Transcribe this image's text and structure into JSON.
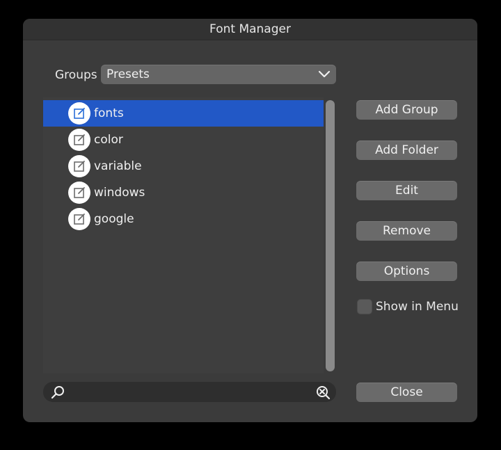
{
  "window": {
    "title": "Font Manager"
  },
  "groups": {
    "label": "Groups",
    "selected": "Presets",
    "icon": "chevron-down-icon"
  },
  "list": {
    "items": [
      {
        "label": "fonts",
        "selected": true,
        "icon": "edit-icon"
      },
      {
        "label": "color",
        "selected": false,
        "icon": "edit-icon"
      },
      {
        "label": "variable",
        "selected": false,
        "icon": "edit-icon"
      },
      {
        "label": "windows",
        "selected": false,
        "icon": "edit-icon"
      },
      {
        "label": "google",
        "selected": false,
        "icon": "edit-icon"
      }
    ]
  },
  "buttons": {
    "add_group": "Add Group",
    "add_folder": "Add Folder",
    "edit": "Edit",
    "remove": "Remove",
    "options": "Options",
    "close": "Close"
  },
  "show_in_menu": {
    "label": "Show in Menu",
    "checked": false
  },
  "search": {
    "value": "",
    "placeholder": ""
  },
  "colors": {
    "selection": "#2258c6",
    "window_bg": "#3b3b3b",
    "button_bg": "#6a6a6a"
  }
}
